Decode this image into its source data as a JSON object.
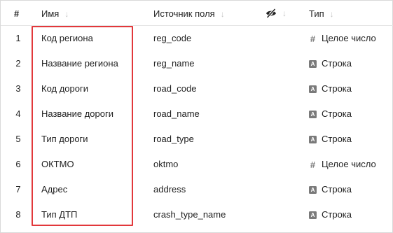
{
  "header": {
    "num": "#",
    "name": "Имя",
    "source": "Источник поля",
    "type": "Тип",
    "sort_arrow": "↓"
  },
  "icons": {
    "hidden": "eye-crossed-icon",
    "string": "string-type-icon",
    "number": "integer-type-icon"
  },
  "colors": {
    "highlight": "#e2383b",
    "icon": "#7a7a7a"
  },
  "rows": [
    {
      "num": "1",
      "name": "Код региона",
      "source": "reg_code",
      "type": "Целое число",
      "icon_glyph": "#"
    },
    {
      "num": "2",
      "name": "Название региона",
      "source": "reg_name",
      "type": "Строка",
      "icon_glyph": "A"
    },
    {
      "num": "3",
      "name": "Код дороги",
      "source": "road_code",
      "type": "Строка",
      "icon_glyph": "A"
    },
    {
      "num": "4",
      "name": "Название дороги",
      "source": "road_name",
      "type": "Строка",
      "icon_glyph": "A"
    },
    {
      "num": "5",
      "name": "Тип дороги",
      "source": "road_type",
      "type": "Строка",
      "icon_glyph": "A"
    },
    {
      "num": "6",
      "name": "ОКТМО",
      "source": "oktmo",
      "type": "Целое число",
      "icon_glyph": "#"
    },
    {
      "num": "7",
      "name": "Адрес",
      "source": "address",
      "type": "Строка",
      "icon_glyph": "A"
    },
    {
      "num": "8",
      "name": "Тип ДТП",
      "source": "crash_type_name",
      "type": "Строка",
      "icon_glyph": "A"
    }
  ]
}
